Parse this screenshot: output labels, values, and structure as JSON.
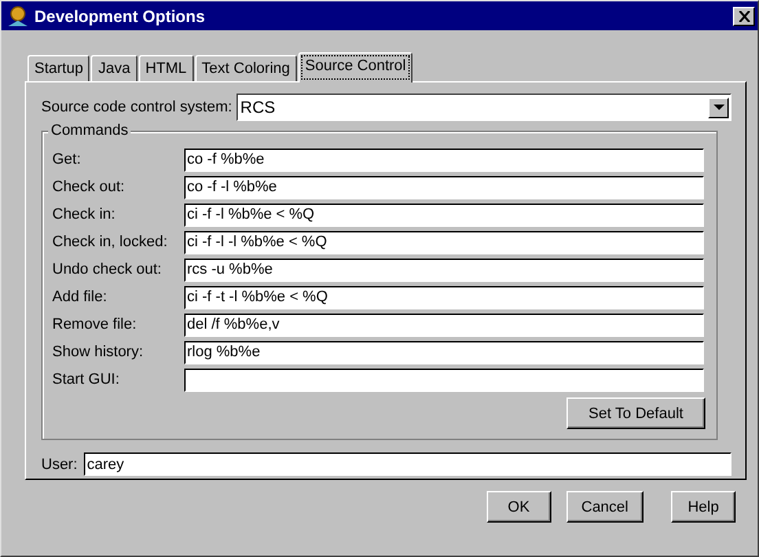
{
  "window": {
    "title": "Development Options"
  },
  "tabs": [
    {
      "label": "Startup",
      "selected": false
    },
    {
      "label": "Java",
      "selected": false
    },
    {
      "label": "HTML",
      "selected": false
    },
    {
      "label": "Text Coloring",
      "selected": false
    },
    {
      "label": "Source Control",
      "selected": true
    }
  ],
  "system": {
    "label": "Source code control system:",
    "value": "RCS"
  },
  "commands": {
    "title": "Commands",
    "rows": [
      {
        "label": "Get:",
        "value": "co -f %b%e"
      },
      {
        "label": "Check out:",
        "value": "co -f -l %b%e"
      },
      {
        "label": "Check in:",
        "value": "ci -f -l %b%e < %Q"
      },
      {
        "label": "Check in, locked:",
        "value": "ci -f -l -l %b%e < %Q"
      },
      {
        "label": "Undo check out:",
        "value": "rcs -u %b%e"
      },
      {
        "label": "Add file:",
        "value": "ci -f -t -l %b%e < %Q"
      },
      {
        "label": "Remove file:",
        "value": "del /f %b%e,v"
      },
      {
        "label": "Show history:",
        "value": "rlog %b%e"
      },
      {
        "label": "Start GUI:",
        "value": ""
      }
    ],
    "default_button": "Set To Default"
  },
  "user": {
    "label": "User:",
    "value": "carey"
  },
  "buttons": [
    "OK",
    "Cancel",
    "Help"
  ]
}
